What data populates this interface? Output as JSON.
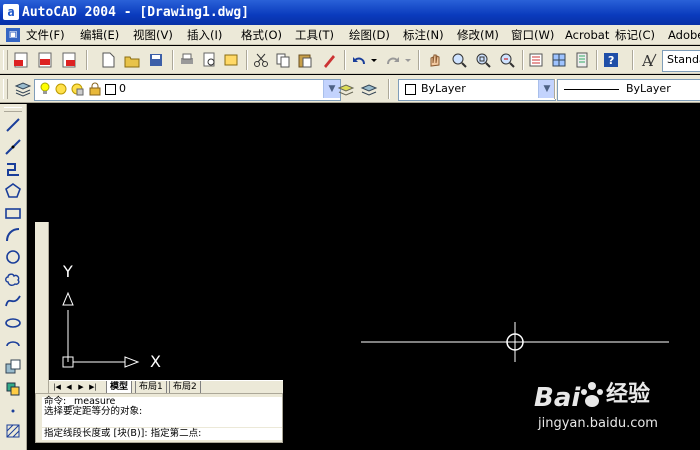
{
  "window": {
    "title": "AutoCAD 2004 - [Drawing1.dwg]"
  },
  "menu": {
    "items": [
      "文件(F)",
      "编辑(E)",
      "视图(V)",
      "插入(I)",
      "格式(O)",
      "工具(T)",
      "绘图(D)",
      "标注(N)",
      "修改(M)",
      "窗口(W)",
      "Acrobat",
      "标记(C)",
      "Adobe"
    ]
  },
  "toolbar": {
    "text_style": "Standa",
    "layer_value": "0",
    "color_value": "ByLayer",
    "linetype_value": "ByLayer"
  },
  "tabs": {
    "model": "模型",
    "layout1": "布局1",
    "layout2": "布局2"
  },
  "command": {
    "lines": [
      "命令: _measure",
      "选择要定距等分的对象:"
    ],
    "prompt": "指定线段长度或 [块(B)]: 指定第二点:"
  },
  "ucs": {
    "x_label": "X",
    "y_label": "Y"
  },
  "watermark": {
    "logo_text": "经验",
    "url": "jingyan.baidu.com"
  },
  "colors": {
    "canvas_bg": "#000000",
    "titlebar": "#0a3bbd",
    "chrome": "#ece9d8",
    "drawing_line": "#ffffff"
  }
}
